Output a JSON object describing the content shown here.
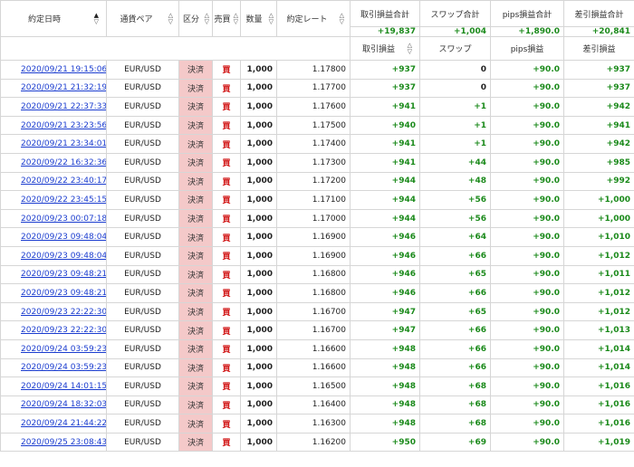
{
  "headers": {
    "date": "約定日時",
    "pair": "通貨ペア",
    "kind": "区分",
    "side": "売買",
    "qty": "数量",
    "rate": "約定レート",
    "pl_total": "取引損益合計",
    "swap_total": "スワップ合計",
    "pips_total": "pips損益合計",
    "net_total": "差引損益合計",
    "pl": "取引損益",
    "swap": "スワップ",
    "pips": "pips損益",
    "net": "差引損益"
  },
  "totals": {
    "pl": "+19,837",
    "swap": "+1,004",
    "pips": "+1,890.0",
    "net": "+20,841"
  },
  "sort_glyphs": {
    "up": "▲",
    "up_open": "△",
    "down": "▽"
  },
  "rows": [
    {
      "date": "2020/09/21 19:15:06",
      "pair": "EUR/USD",
      "kind": "決済",
      "side": "買",
      "qty": "1,000",
      "rate": "1.17800",
      "pl": "+937",
      "swap": "0",
      "pips": "+90.0",
      "net": "+937"
    },
    {
      "date": "2020/09/21 21:32:19",
      "pair": "EUR/USD",
      "kind": "決済",
      "side": "買",
      "qty": "1,000",
      "rate": "1.17700",
      "pl": "+937",
      "swap": "0",
      "pips": "+90.0",
      "net": "+937"
    },
    {
      "date": "2020/09/21 22:37:33",
      "pair": "EUR/USD",
      "kind": "決済",
      "side": "買",
      "qty": "1,000",
      "rate": "1.17600",
      "pl": "+941",
      "swap": "+1",
      "pips": "+90.0",
      "net": "+942"
    },
    {
      "date": "2020/09/21 23:23:56",
      "pair": "EUR/USD",
      "kind": "決済",
      "side": "買",
      "qty": "1,000",
      "rate": "1.17500",
      "pl": "+940",
      "swap": "+1",
      "pips": "+90.0",
      "net": "+941"
    },
    {
      "date": "2020/09/21 23:34:01",
      "pair": "EUR/USD",
      "kind": "決済",
      "side": "買",
      "qty": "1,000",
      "rate": "1.17400",
      "pl": "+941",
      "swap": "+1",
      "pips": "+90.0",
      "net": "+942"
    },
    {
      "date": "2020/09/22 16:32:36",
      "pair": "EUR/USD",
      "kind": "決済",
      "side": "買",
      "qty": "1,000",
      "rate": "1.17300",
      "pl": "+941",
      "swap": "+44",
      "pips": "+90.0",
      "net": "+985"
    },
    {
      "date": "2020/09/22 23:40:17",
      "pair": "EUR/USD",
      "kind": "決済",
      "side": "買",
      "qty": "1,000",
      "rate": "1.17200",
      "pl": "+944",
      "swap": "+48",
      "pips": "+90.0",
      "net": "+992"
    },
    {
      "date": "2020/09/22 23:45:15",
      "pair": "EUR/USD",
      "kind": "決済",
      "side": "買",
      "qty": "1,000",
      "rate": "1.17100",
      "pl": "+944",
      "swap": "+56",
      "pips": "+90.0",
      "net": "+1,000"
    },
    {
      "date": "2020/09/23 00:07:18",
      "pair": "EUR/USD",
      "kind": "決済",
      "side": "買",
      "qty": "1,000",
      "rate": "1.17000",
      "pl": "+944",
      "swap": "+56",
      "pips": "+90.0",
      "net": "+1,000"
    },
    {
      "date": "2020/09/23 09:48:04",
      "pair": "EUR/USD",
      "kind": "決済",
      "side": "買",
      "qty": "1,000",
      "rate": "1.16900",
      "pl": "+946",
      "swap": "+64",
      "pips": "+90.0",
      "net": "+1,010"
    },
    {
      "date": "2020/09/23 09:48:04",
      "pair": "EUR/USD",
      "kind": "決済",
      "side": "買",
      "qty": "1,000",
      "rate": "1.16900",
      "pl": "+946",
      "swap": "+66",
      "pips": "+90.0",
      "net": "+1,012"
    },
    {
      "date": "2020/09/23 09:48:21",
      "pair": "EUR/USD",
      "kind": "決済",
      "side": "買",
      "qty": "1,000",
      "rate": "1.16800",
      "pl": "+946",
      "swap": "+65",
      "pips": "+90.0",
      "net": "+1,011"
    },
    {
      "date": "2020/09/23 09:48:21",
      "pair": "EUR/USD",
      "kind": "決済",
      "side": "買",
      "qty": "1,000",
      "rate": "1.16800",
      "pl": "+946",
      "swap": "+66",
      "pips": "+90.0",
      "net": "+1,012"
    },
    {
      "date": "2020/09/23 22:22:30",
      "pair": "EUR/USD",
      "kind": "決済",
      "side": "買",
      "qty": "1,000",
      "rate": "1.16700",
      "pl": "+947",
      "swap": "+65",
      "pips": "+90.0",
      "net": "+1,012"
    },
    {
      "date": "2020/09/23 22:22:30",
      "pair": "EUR/USD",
      "kind": "決済",
      "side": "買",
      "qty": "1,000",
      "rate": "1.16700",
      "pl": "+947",
      "swap": "+66",
      "pips": "+90.0",
      "net": "+1,013"
    },
    {
      "date": "2020/09/24 03:59:23",
      "pair": "EUR/USD",
      "kind": "決済",
      "side": "買",
      "qty": "1,000",
      "rate": "1.16600",
      "pl": "+948",
      "swap": "+66",
      "pips": "+90.0",
      "net": "+1,014"
    },
    {
      "date": "2020/09/24 03:59:23",
      "pair": "EUR/USD",
      "kind": "決済",
      "side": "買",
      "qty": "1,000",
      "rate": "1.16600",
      "pl": "+948",
      "swap": "+66",
      "pips": "+90.0",
      "net": "+1,014"
    },
    {
      "date": "2020/09/24 14:01:15",
      "pair": "EUR/USD",
      "kind": "決済",
      "side": "買",
      "qty": "1,000",
      "rate": "1.16500",
      "pl": "+948",
      "swap": "+68",
      "pips": "+90.0",
      "net": "+1,016"
    },
    {
      "date": "2020/09/24 18:32:03",
      "pair": "EUR/USD",
      "kind": "決済",
      "side": "買",
      "qty": "1,000",
      "rate": "1.16400",
      "pl": "+948",
      "swap": "+68",
      "pips": "+90.0",
      "net": "+1,016"
    },
    {
      "date": "2020/09/24 21:44:22",
      "pair": "EUR/USD",
      "kind": "決済",
      "side": "買",
      "qty": "1,000",
      "rate": "1.16300",
      "pl": "+948",
      "swap": "+68",
      "pips": "+90.0",
      "net": "+1,016"
    },
    {
      "date": "2020/09/25 23:08:43",
      "pair": "EUR/USD",
      "kind": "決済",
      "side": "買",
      "qty": "1,000",
      "rate": "1.16200",
      "pl": "+950",
      "swap": "+69",
      "pips": "+90.0",
      "net": "+1,019"
    }
  ]
}
